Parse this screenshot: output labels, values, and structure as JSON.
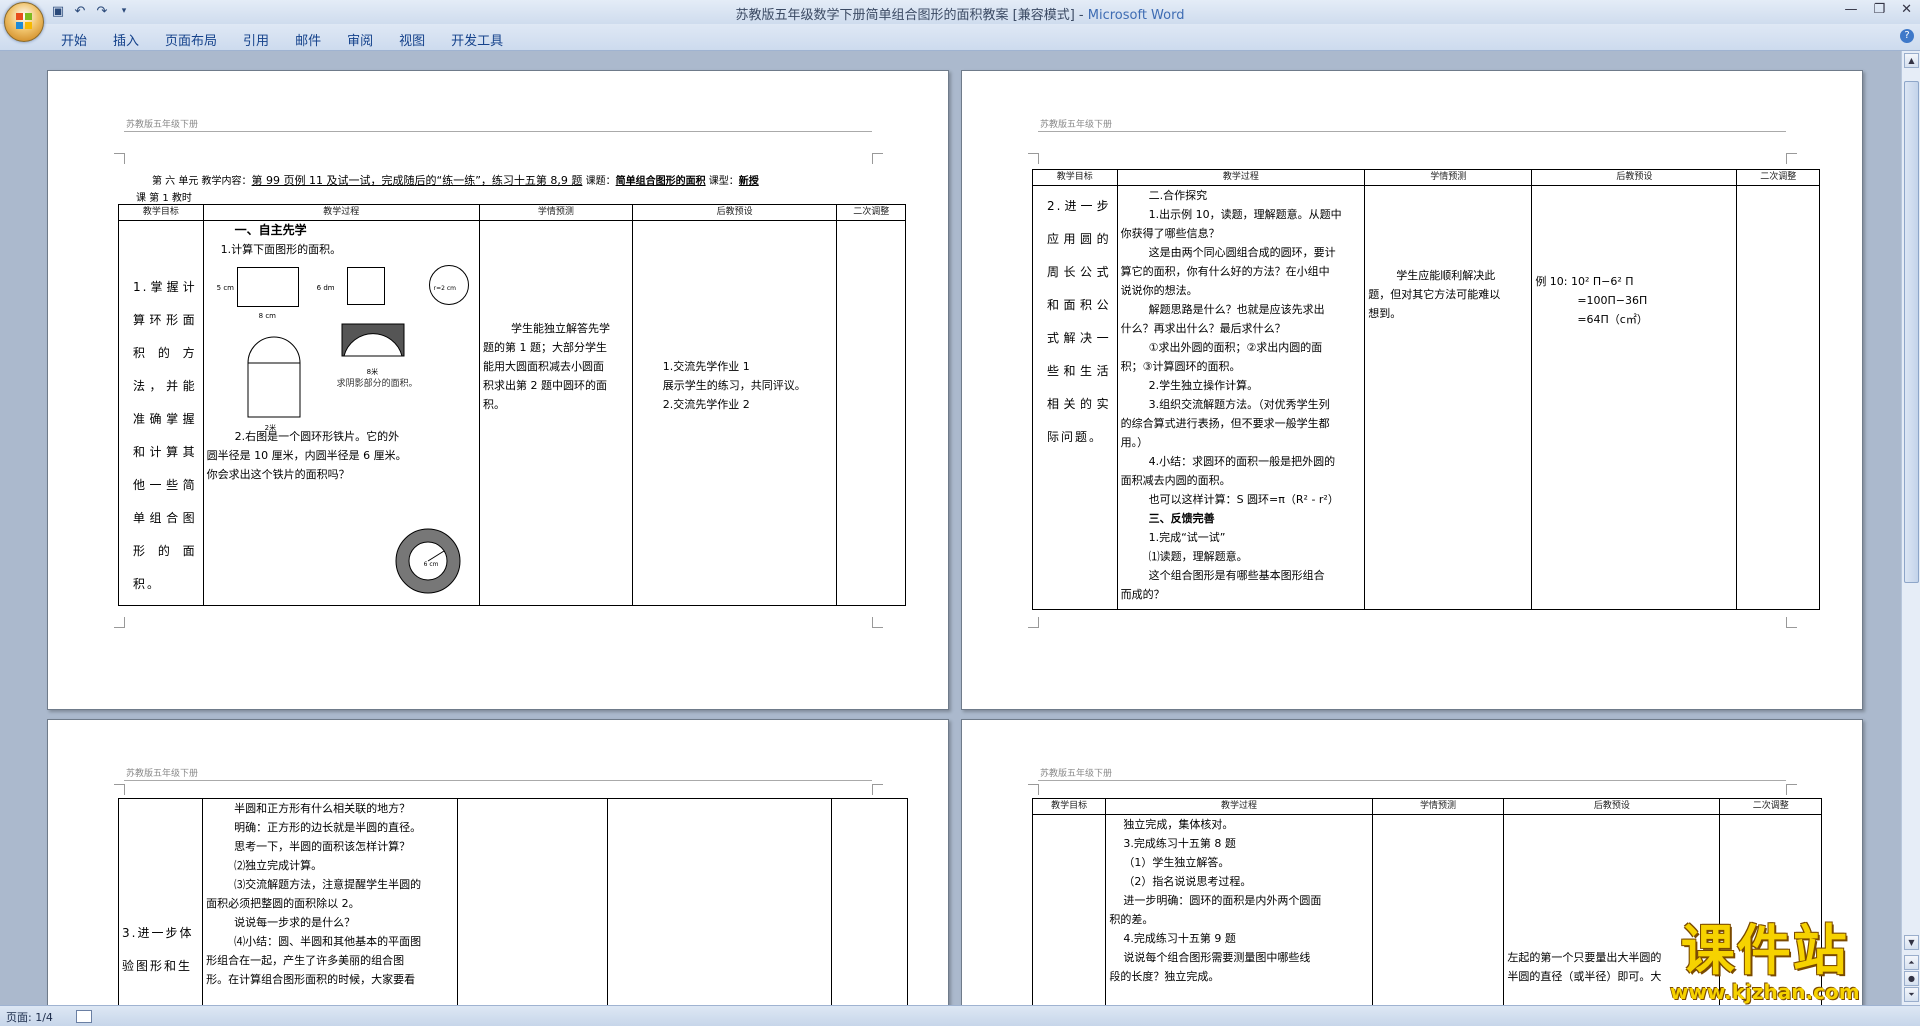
{
  "window": {
    "title": "苏教版五年级数学下册简单组合图形的面积教案 [兼容模式] - ",
    "app_name": "Microsoft Word",
    "controls": [
      "—",
      "❐",
      "✕"
    ]
  },
  "ribbon": {
    "tabs": [
      "开始",
      "插入",
      "页面布局",
      "引用",
      "邮件",
      "审阅",
      "视图",
      "开发工具"
    ]
  },
  "doc": {
    "header_text": "苏教版五年级下册",
    "page1": {
      "info_line1_a": "第  六  单元   教学内容：",
      "info_line1_b": "第 99 页例 11 及试一试，完成随后的“练一练”，练习十五第 8,9 题",
      "info_line1_c": "  课题：",
      "info_line1_d": "简单组合图形的面积",
      "info_line1_e": "  课型：",
      "info_line1_f": "新授",
      "info_line2": "课    第   1    教时",
      "col_headers": [
        "教学目标",
        "教学过程",
        "学情预测",
        "后教预设",
        "二次调整"
      ],
      "goal": "1.掌握计算环形面积的方法，并能准确掌握和计算其他一些简单组合图形的面积。",
      "process_heading": "一、自主先学",
      "process_q1": "1.计算下面图形的面积。",
      "fig_label_5cm": "5 cm",
      "fig_label_8cm": "8 cm",
      "fig_label_6dm": "6 dm",
      "fig_label_r": "r=2 cm",
      "fig_label_8m": "8米",
      "fig_label_2m": "2米",
      "fig_caption": "求阴影部分的面积。",
      "process_q2": [
        "2.右图是一个圆环形铁片。它的外",
        "圆半径是 10 厘米，内圆半径是 6 厘米。",
        "你会求出这个铁片的面积吗？"
      ],
      "ring_label": "6 cm",
      "predict": [
        "学生能独立解答先学",
        "题的第 1 题；大部分学生",
        "能用大圆面积减去小圆面",
        "积求出第 2 题中圆环的面",
        "积。"
      ],
      "preset": [
        "1.交流先学作业 1",
        "展示学生的练习，共同评议。",
        "2.交流先学作业 2"
      ]
    },
    "page2": {
      "col_headers": [
        "教学目标",
        "教学过程",
        "学情预测",
        "后教预设",
        "二次调整"
      ],
      "goal": "2.进一步应用圆的周长公式和面积公式解决一些和生活相关的实际问题。",
      "process": [
        "二.合作探究",
        "1.出示例 10，读题，理解题意。从题中",
        "你获得了哪些信息？",
        "这是由两个同心圆组合成的圆环，要计",
        "算它的面积，你有什么好的方法？在小组中",
        "说说你的想法。",
        "解题思路是什么？也就是应该先求出",
        "什么？再求出什么？最后求什么？",
        "①求出外圆的面积；②求出内圆的面",
        "积；③计算圆环的面积。",
        "2.学生独立操作计算。",
        "3.组织交流解题方法。（对优秀学生列",
        "的综合算式进行表扬，但不要求一般学生都",
        "用。）",
        "4.小结：求圆环的面积一般是把外圆的",
        "面积减去内圆的面积。",
        "也可以这样计算：S 圆环=π（R² - r²）",
        "三、反馈完善",
        "1.完成“试一试”",
        "⑴读题，理解题意。",
        "这个组合图形是有哪些基本图形组合",
        "而成的？"
      ],
      "predict": [
        "学生应能顺利解决此",
        "题，但对其它方法可能难以",
        "想到。"
      ],
      "preset": [
        "例 10:   10² Π−6² Π",
        "=100Π−36Π",
        "=64Π（c㎡）"
      ]
    },
    "page3": {
      "goal": "3.进一步体验图形和生",
      "process": [
        "半圆和正方形有什么相关联的地方？",
        "明确：正方形的边长就是半圆的直径。",
        "思考一下，半圆的面积该怎样计算？",
        "⑵独立完成计算。",
        "⑶交流解题方法，注意提醒学生半圆的",
        "面积必须把整圆的面积除以 2。",
        "说说每一步求的是什么？",
        "⑷小结：圆、半圆和其他基本的平面图",
        "形组合在一起，产生了许多美丽的组合图",
        "形。在计算组合图形面积的时候，大家要看"
      ]
    },
    "page4": {
      "col_headers": [
        "教学目标",
        "教学过程",
        "学情预测",
        "后教预设",
        "二次调整"
      ],
      "process": [
        "独立完成，集体核对。",
        "3.完成练习十五第 8 题",
        "（1）学生独立解答。",
        "（2）指名说说思考过程。",
        "进一步明确：圆环的面积是内外两个圆面",
        "积的差。",
        "4.完成练习十五第 9 题",
        "说说每个组合图形需要测量图中哪些线",
        "段的长度？独立完成。"
      ],
      "preset": [
        "左起的第一个只要量出大半圆的",
        "半圆的直径（或半径）即可。大"
      ]
    }
  },
  "status": {
    "page_label": "页面: 1/4"
  },
  "watermark": {
    "brand": "课件站",
    "url": "www.kjzhan.com"
  },
  "icons": {
    "save": "save-icon",
    "undo": "undo-icon",
    "redo": "redo-icon"
  }
}
